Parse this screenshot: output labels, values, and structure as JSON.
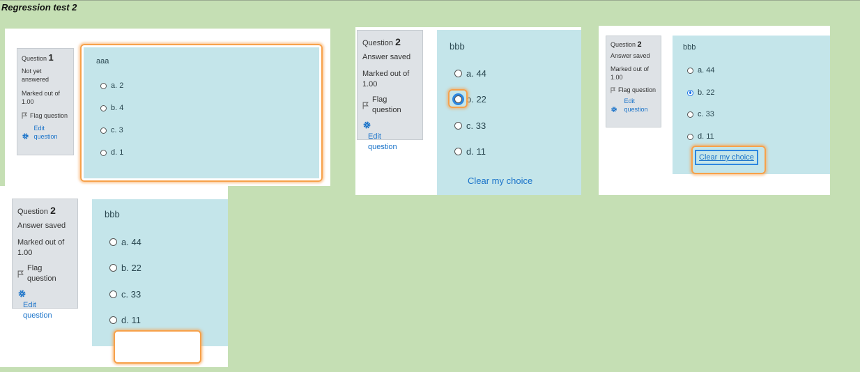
{
  "heading": "Regression test 2",
  "panels": [
    {
      "question_label": "Question",
      "question_number": "1",
      "state": "Not yet answered",
      "marked": "Marked out of 1.00",
      "flag_label": "Flag question",
      "edit_label": "Edit question",
      "question_text": "aaa",
      "options": [
        {
          "label": "a. 2",
          "checked": false
        },
        {
          "label": "b. 4",
          "checked": false
        },
        {
          "label": "c. 3",
          "checked": false
        },
        {
          "label": "d. 1",
          "checked": false
        }
      ]
    },
    {
      "question_label": "Question",
      "question_number": "2",
      "state": "Answer saved",
      "marked": "Marked out of 1.00",
      "flag_label": "Flag question",
      "edit_label": "Edit question",
      "question_text": "bbb",
      "options": [
        {
          "label": "a. 44",
          "checked": false
        },
        {
          "label": "b. 22",
          "checked": false
        },
        {
          "label": "c. 33",
          "checked": false
        },
        {
          "label": "d. 11",
          "checked": false
        }
      ],
      "clear_label": "Clear my choice"
    },
    {
      "question_label": "Question",
      "question_number": "2",
      "state": "Answer saved",
      "marked": "Marked out of 1.00",
      "flag_label": "Flag question",
      "edit_label": "Edit question",
      "question_text": "bbb",
      "options": [
        {
          "label": "a. 44",
          "checked": false
        },
        {
          "label": "b. 22",
          "checked": true
        },
        {
          "label": "c. 33",
          "checked": false
        },
        {
          "label": "d. 11",
          "checked": false
        }
      ],
      "clear_label": "Clear my choice"
    },
    {
      "question_label": "Question",
      "question_number": "2",
      "state": "Answer saved",
      "marked": "Marked out of 1.00",
      "flag_label": "Flag question",
      "edit_label": "Edit question",
      "question_text": "bbb",
      "options": [
        {
          "label": "a. 44",
          "checked": false
        },
        {
          "label": "b. 22",
          "checked": false
        },
        {
          "label": "c. 33",
          "checked": false
        },
        {
          "label": "d. 11",
          "checked": false
        }
      ]
    }
  ],
  "colors": {
    "background": "#c5dfb4",
    "info_panel": "#dee2e6",
    "content_panel": "#c4e5ea",
    "link": "#1a73c9",
    "highlight": "#f7a14a"
  }
}
